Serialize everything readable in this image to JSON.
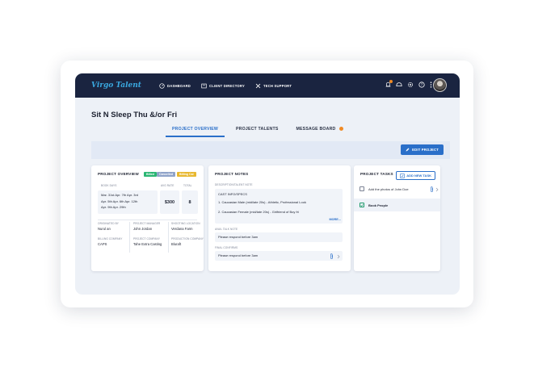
{
  "app": {
    "logo": "Virgo Talent"
  },
  "nav": [
    {
      "label": "DASHBOARD",
      "icon": "dashboard-gauge-icon"
    },
    {
      "label": "CLIENT DIRECTORY",
      "icon": "directory-icon"
    },
    {
      "label": "TECH SUPPORT",
      "icon": "tools-icon"
    }
  ],
  "header_icons": [
    "notification-bell-icon",
    "helmet-icon",
    "settings-gear-icon",
    "help-icon",
    "more-vertical-icon"
  ],
  "project": {
    "title": "Sit N Sleep Thu &/or Fri"
  },
  "tabs": [
    {
      "label": "PROJECT OVERVIEW",
      "active": true
    },
    {
      "label": "PROJECT TALENTS",
      "active": false
    },
    {
      "label": "MESSAGE BOARD",
      "active": false
    }
  ],
  "toolbar": {
    "edit_label": "EDIT PROJECT"
  },
  "overview": {
    "title": "PROJECT OVERVIEW",
    "tags": [
      {
        "label": "Billed",
        "color": "#2bb673"
      },
      {
        "label": "Cancelled",
        "color": "#8fa3c9"
      },
      {
        "label": "Billing Cal",
        "color": "#e8b830"
      }
    ],
    "dates_label": "BOOK DAYS",
    "rate_label": "AVG RATE",
    "count_label": "TOTAL",
    "dates_rows": [
      "Mar. 31st   Apr. 7th   Apr. 3rd",
      "Apr. 5th   Apr. 6th   Apr. 12th",
      "Apr. 9th   Apr. 29th"
    ],
    "rate": "$300",
    "count": "8",
    "meta": [
      {
        "label": "ORIGINATED BY",
        "value": "Nurul an"
      },
      {
        "label": "PROJECT MANAGER",
        "value": "John Jordan"
      },
      {
        "label": "SHOOTING LOCATION",
        "value": "Verdana Farm"
      },
      {
        "label": "BILLING COMPANY",
        "value": "CAPS"
      },
      {
        "label": "PROJECT COMPANY",
        "value": "Tahe Extra Casting"
      },
      {
        "label": "PRODUCTION COMPANY",
        "value": "Bluraft"
      }
    ]
  },
  "notes": {
    "title": "PROJECT NOTES",
    "description_label": "DESCRIPTION/TALENT NOTE",
    "cast_heading": "CAST INFO/SPECS",
    "cast_lines": [
      "1. Caucasian Male (mid/late 20s) - Athletic, Professional Look",
      "2. Caucasian Female (mid/late 20s) - Girlfriend of Boy fri"
    ],
    "more_label": "MORE...",
    "avail_label": "AVAIL TALK NOTE",
    "avail_text": "Please respond before 3am",
    "final_label": "FINAL CONFIRMS",
    "final_text": "Please respond before 3am"
  },
  "tasks": {
    "title": "PROJECT TASKS",
    "add_label": "ADD NEW TASK",
    "items": [
      {
        "label": "Add the photos of John Doe",
        "done": false
      },
      {
        "label": "Book People",
        "done": true
      }
    ]
  }
}
